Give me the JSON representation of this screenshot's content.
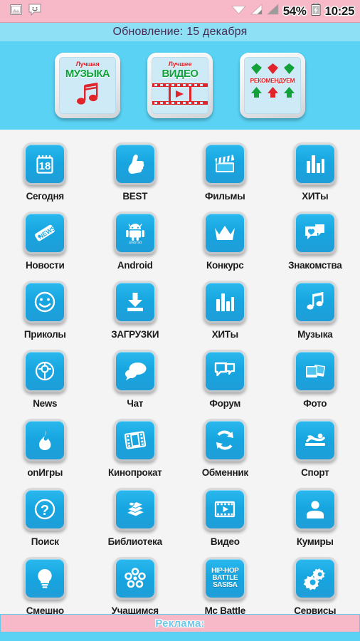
{
  "status_bar": {
    "left_icons": [
      {
        "name": "gallery-icon",
        "label": "gallery"
      },
      {
        "name": "sms-smiley-icon",
        "label": "messaging"
      }
    ],
    "right_icons": [
      {
        "name": "wifi-icon",
        "label": "wifi"
      },
      {
        "name": "signal-sim1-icon",
        "label": "signal-1"
      },
      {
        "name": "signal-sim2-icon",
        "label": "signal-2"
      },
      {
        "name": "battery-charging-icon",
        "label": "battery"
      }
    ],
    "battery_percent": "54%",
    "clock": "10:25",
    "background_color": "#f7b9c8"
  },
  "header": {
    "title": "Обновление: 15 декабря",
    "background_color": "#8ee0f5",
    "text_color": "#4b2a52"
  },
  "promo": {
    "background_color": "#5ad2f4",
    "tiles": [
      {
        "name": "promo-best-music",
        "top_text": "Лучшая",
        "main_text": "МУЗЫКА",
        "art": "music-note-icon"
      },
      {
        "name": "promo-best-video",
        "top_text": "Лучшее",
        "main_text": "ВИДЕО",
        "art": "film-strip-play-icon"
      },
      {
        "name": "promo-recommended",
        "top_text": "",
        "main_text": "",
        "label_text": "РЕКОМЕНДУЕМ",
        "art": "diamond-tree-icon"
      }
    ]
  },
  "grid": {
    "accent_color": "#1fabe4",
    "background_color": "#f4f4f4",
    "items": [
      {
        "label": "Сегодня",
        "icon": "calendar-18-icon"
      },
      {
        "label": "BEST",
        "icon": "thumbs-up-icon"
      },
      {
        "label": "Фильмы",
        "icon": "clapperboard-icon"
      },
      {
        "label": "ХИТы",
        "icon": "bar-chart-icon"
      },
      {
        "label": "Новости",
        "icon": "news-tag-icon"
      },
      {
        "label": "Android",
        "icon": "android-robot-icon"
      },
      {
        "label": "Конкурс",
        "icon": "crown-icon"
      },
      {
        "label": "Знакомства",
        "icon": "chat-heart-icon"
      },
      {
        "label": "Приколы",
        "icon": "smiley-face-icon"
      },
      {
        "label": "ЗАГРУЗКИ",
        "icon": "download-arrow-icon"
      },
      {
        "label": "ХИТы",
        "icon": "bar-chart-icon"
      },
      {
        "label": "Музыка",
        "icon": "music-note-icon"
      },
      {
        "label": "News",
        "icon": "compass-target-icon"
      },
      {
        "label": "Чат",
        "icon": "speech-bubbles-filled-icon"
      },
      {
        "label": "Форум",
        "icon": "speech-bubbles-outline-icon"
      },
      {
        "label": "Фото",
        "icon": "photos-stack-icon"
      },
      {
        "label": "onИгры",
        "icon": "flame-icon"
      },
      {
        "label": "Кинопрокат",
        "icon": "film-reel-icon"
      },
      {
        "label": "Обменник",
        "icon": "refresh-cycle-icon"
      },
      {
        "label": "Спорт",
        "icon": "swimmer-icon"
      },
      {
        "label": "Поиск",
        "icon": "question-circle-icon"
      },
      {
        "label": "Библиотека",
        "icon": "books-stack-icon"
      },
      {
        "label": "Видео",
        "icon": "video-film-play-icon"
      },
      {
        "label": "Кумиры",
        "icon": "person-bust-icon"
      },
      {
        "label": "Смешно",
        "icon": "lightbulb-icon"
      },
      {
        "label": "Учащимся",
        "icon": "flower-icon"
      },
      {
        "label": "Mc Battle",
        "icon": "hip-hop-battle-text-icon",
        "icon_lines": [
          "HIP-HOP",
          "BATTLE",
          "SASISA"
        ]
      },
      {
        "label": "Сервисы",
        "icon": "gears-icon"
      }
    ]
  },
  "footer": {
    "ad_label": "Реклама:",
    "ad_background_color": "#f7b9c8",
    "ad_text_color": "#6fc9e8",
    "strip_color": "#5ad2f4"
  }
}
